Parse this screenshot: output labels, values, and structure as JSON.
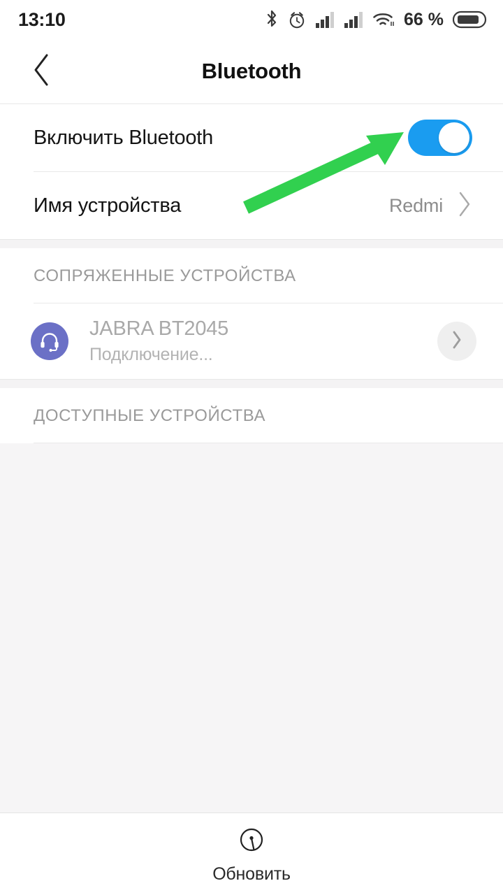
{
  "statusbar": {
    "time": "13:10",
    "battery_percent": "66 %",
    "icons": [
      "bluetooth-icon",
      "alarm-icon",
      "signal-sim1-icon",
      "signal-sim2-icon",
      "wifi-icon",
      "battery-icon"
    ]
  },
  "header": {
    "title": "Bluetooth",
    "back_icon": "chevron-left-icon"
  },
  "settings": {
    "bluetooth_toggle": {
      "label": "Включить Bluetooth",
      "state": "on"
    },
    "device_name": {
      "label": "Имя устройства",
      "value": "Redmi",
      "chevron": "chevron-right-icon"
    }
  },
  "paired": {
    "section_title": "СОПРЯЖЕННЫЕ УСТРОЙСТВА",
    "devices": [
      {
        "name": "JABRA BT2045",
        "status": "Подключение...",
        "icon": "headset-icon",
        "icon_color": "#6b70c6",
        "action_icon": "chevron-right-icon"
      }
    ]
  },
  "available": {
    "section_title": "ДОСТУПНЫЕ УСТРОЙСТВА",
    "devices": []
  },
  "bottom_bar": {
    "refresh_label": "Обновить",
    "refresh_icon": "scan-refresh-icon"
  },
  "annotation": {
    "type": "arrow",
    "color": "#31d04f",
    "points_to": "bluetooth-toggle"
  },
  "colors": {
    "accent": "#1a9cf0",
    "page_bg": "#f6f5f6",
    "card_bg": "#ffffff",
    "divider": "#e9e9e9",
    "muted_text": "#9a9a9a",
    "annotation_green": "#31d04f"
  }
}
